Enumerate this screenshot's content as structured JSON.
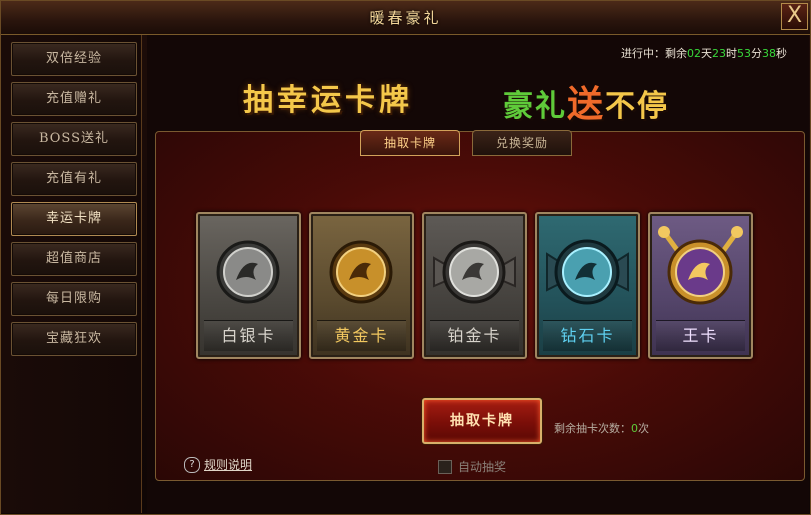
{
  "window": {
    "title": "暖春豪礼",
    "close_label": "X"
  },
  "sidebar": {
    "items": [
      {
        "label": "双倍经验"
      },
      {
        "label": "充值赠礼"
      },
      {
        "label": "BOSS送礼"
      },
      {
        "label": "充值有礼"
      },
      {
        "label": "幸运卡牌",
        "active": true
      },
      {
        "label": "超值商店"
      },
      {
        "label": "每日限购"
      },
      {
        "label": "宝藏狂欢"
      }
    ]
  },
  "timer": {
    "prefix": "进行中：剩余",
    "days": "02",
    "days_unit": "天",
    "hours": "23",
    "hours_unit": "时",
    "minutes": "53",
    "minutes_unit": "分",
    "seconds": "38",
    "seconds_unit": "秒"
  },
  "banner": {
    "left": "抽幸运卡牌",
    "right_1": "豪礼",
    "right_2": "送",
    "right_3": "不停"
  },
  "tabs": [
    {
      "label": "抽取卡牌",
      "active": true
    },
    {
      "label": "兑换奖励",
      "active": false
    }
  ],
  "cards": [
    {
      "label": "白银卡",
      "icon": "silver-medallion-icon",
      "label_color": "#d8d4cc",
      "coin_color": "#8a8a88"
    },
    {
      "label": "黄金卡",
      "icon": "gold-medallion-icon",
      "label_color": "#f2c860",
      "coin_color": "#c8902a"
    },
    {
      "label": "铂金卡",
      "icon": "platinum-medallion-icon",
      "label_color": "#d8d4cc",
      "coin_color": "#a8a8a4"
    },
    {
      "label": "钻石卡",
      "icon": "diamond-medallion-icon",
      "label_color": "#5fd0f0",
      "coin_color": "#4aa0b0"
    },
    {
      "label": "王卡",
      "icon": "king-medallion-icon",
      "label_color": "#f0e0ff",
      "coin_color": "#6a3a8a"
    }
  ],
  "draw_button": {
    "label": "抽取卡牌"
  },
  "remaining": {
    "label": "剩余抽卡次数：",
    "count": "0",
    "unit": "次"
  },
  "help": {
    "icon": "question-circle-icon",
    "label": "规则说明"
  },
  "auto_draw": {
    "label": "自动抽奖",
    "checked": false
  }
}
